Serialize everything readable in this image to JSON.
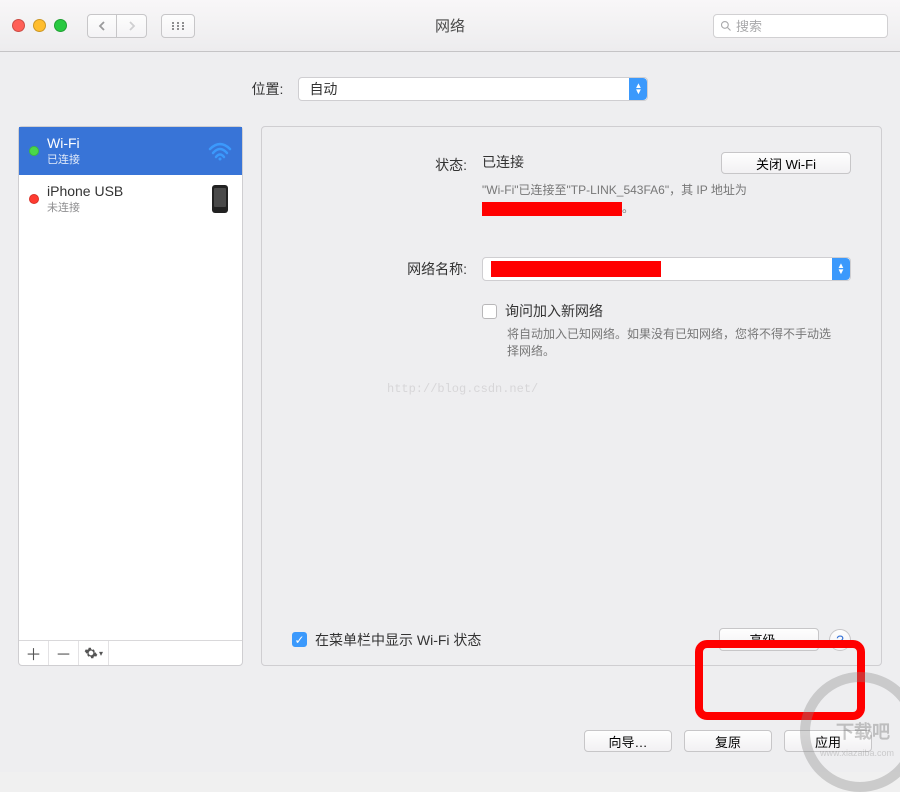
{
  "window": {
    "title": "网络"
  },
  "search": {
    "placeholder": "搜索"
  },
  "location": {
    "label": "位置:",
    "value": "自动"
  },
  "sidebar": {
    "items": [
      {
        "name": "Wi-Fi",
        "status_label": "已连接",
        "status": "green",
        "selected": true,
        "icon": "wifi"
      },
      {
        "name": "iPhone USB",
        "status_label": "未连接",
        "status": "red",
        "selected": false,
        "icon": "phone"
      }
    ]
  },
  "detail": {
    "status_label": "状态:",
    "status_value": "已连接",
    "toggle_button": "关闭 Wi-Fi",
    "status_desc_prefix": "\"Wi-Fi\"已连接至\"",
    "status_desc_network": "TP-LINK_543FA6",
    "status_desc_mid": "\"，其 IP 地址为",
    "network_name_label": "网络名称:",
    "ask_join_label": "询问加入新网络",
    "ask_join_desc": "将自动加入已知网络。如果没有已知网络，您将不得不手动选择网络。",
    "show_in_menubar": "在菜单栏中显示 Wi-Fi 状态",
    "advanced_button": "高级…"
  },
  "footer": {
    "assist": "向导…",
    "revert": "复原",
    "apply": "应用"
  },
  "watermark_url": "http://blog.csdn.net/",
  "site_watermark": {
    "name": "下载吧",
    "url": "www.xiazaiba.com"
  }
}
